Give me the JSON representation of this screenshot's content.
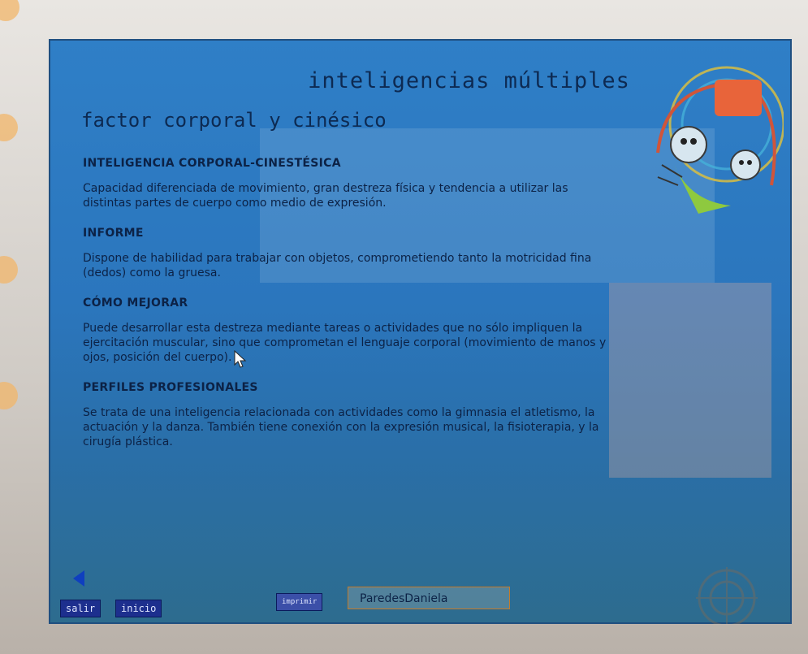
{
  "app": {
    "title": "inteligencias múltiples",
    "subtitle": "factor corporal y cinésico"
  },
  "sections": [
    {
      "heading": "INTELIGENCIA CORPORAL-CINESTÉSICA",
      "body": "Capacidad diferenciada de movimiento, gran destreza física y tendencia a utilizar las distintas partes de cuerpo como medio de expresión."
    },
    {
      "heading": "INFORME",
      "body": "Dispone de habilidad para trabajar con objetos, comprometiendo tanto la motricidad fina (dedos) como la gruesa."
    },
    {
      "heading": "CÓMO MEJORAR",
      "body": "Puede desarrollar esta destreza mediante tareas o actividades que no sólo impliquen la ejercitación muscular, sino que comprometan el lenguaje corporal (movimiento de manos y ojos, posición del cuerpo)."
    },
    {
      "heading": "PERFILES PROFESIONALES",
      "body": "Se trata de una inteligencia relacionada con actividades como la gimnasia el atletismo, la actuación y la danza. También tiene conexión con la expresión musical, la fisioterapia, y la cirugía plástica."
    }
  ],
  "footer": {
    "salir_label": "salir",
    "inicio_label": "inicio",
    "imprimir_label": "imprimir",
    "name_value": "ParedesDaniela"
  },
  "icons": {
    "back": "back-arrow-icon",
    "logo": "kids-logo",
    "target": "target-icon",
    "cursor": "mouse-cursor-icon"
  },
  "colors": {
    "screen_bg": "#2f7fc7",
    "text": "#0c2246",
    "button_bg": "#1d2f8e",
    "field_border": "#c47b2a"
  }
}
